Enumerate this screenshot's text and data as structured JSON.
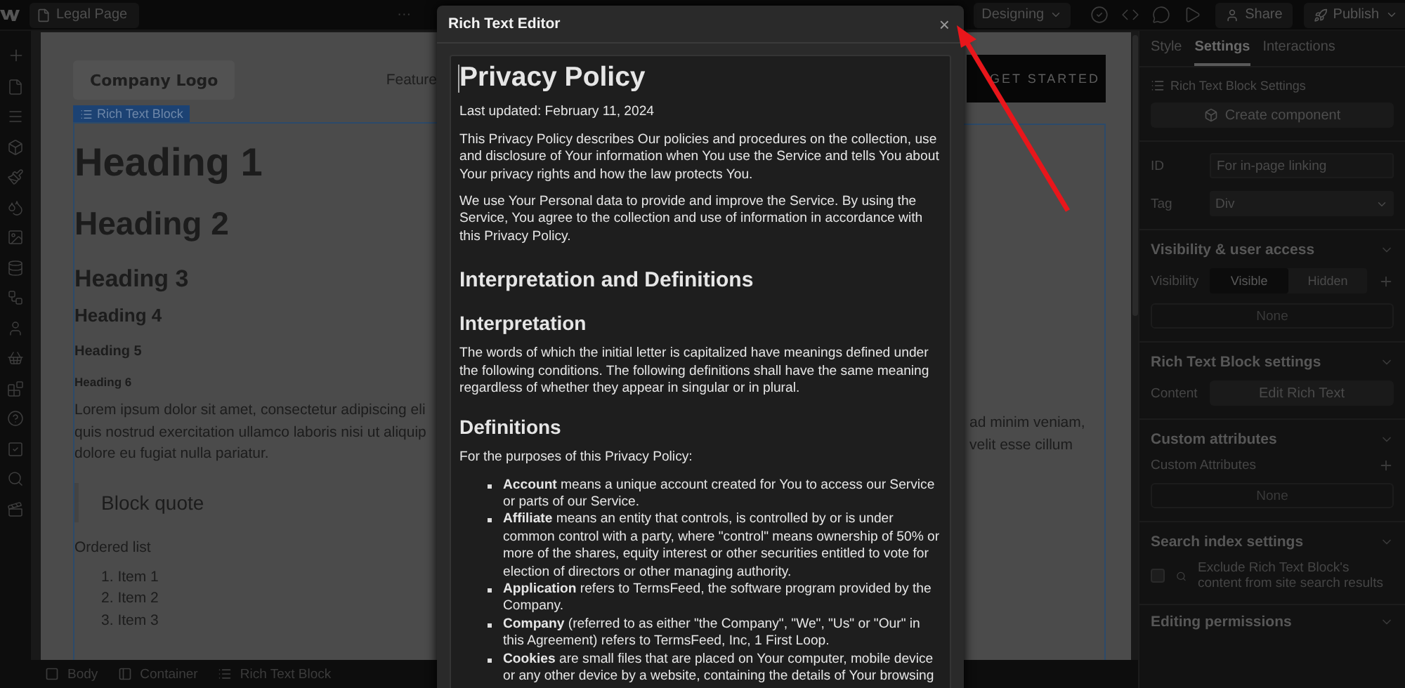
{
  "top_bar": {
    "page_button": "Legal Page",
    "more": "···",
    "mode_dropdown": "Designing",
    "share_button": "Share",
    "publish_button": "Publish"
  },
  "canvas": {
    "logo_button": "Company Logo",
    "nav_link": "Feature",
    "cta_button": "GET STARTED",
    "element_tag": "Rich Text Block",
    "headings": [
      {
        "kind": "h1",
        "text": "Heading 1"
      },
      {
        "kind": "h2",
        "text": "Heading 2"
      },
      {
        "kind": "h3",
        "text": "Heading 3"
      },
      {
        "kind": "h4",
        "text": "Heading 4"
      },
      {
        "kind": "h5",
        "text": "Heading 5"
      },
      {
        "kind": "h6",
        "text": "Heading 6"
      }
    ],
    "paragraph_left_lines": [
      "Lorem ipsum dolor sit amet, consectetur adipiscing eli",
      "quis nostrud exercitation ullamco laboris nisi ut aliquip",
      "dolore eu fugiat nulla pariatur."
    ],
    "paragraph_right_lines": [
      "ad minim veniam,",
      "velit esse cillum"
    ],
    "block_quote": "Block quote",
    "list_label": "Ordered list",
    "list_items": [
      {
        "marker": "1.",
        "text": "Item 1"
      },
      {
        "marker": "2.",
        "text": "Item 2"
      },
      {
        "marker": "3.",
        "text": "Item 3"
      }
    ]
  },
  "breadcrumbs": [
    {
      "kind": "body",
      "label": "Body"
    },
    {
      "kind": "container",
      "label": "Container"
    },
    {
      "kind": "richtext",
      "label": "Rich Text Block"
    }
  ],
  "modal": {
    "title": "Rich Text Editor",
    "close": "×",
    "content": [
      {
        "kind": "h1",
        "text": "Privacy Policy"
      },
      {
        "kind": "p",
        "text": "Last updated: February 11, 2024"
      },
      {
        "kind": "p",
        "text": "This Privacy Policy describes Our policies and procedures on the collection, use and disclosure of Your information when You use the Service and tells You about Your privacy rights and how the law protects You."
      },
      {
        "kind": "p",
        "text": "We use Your Personal data to provide and improve the Service. By using the Service, You agree to the collection and use of information in accordance with this Privacy Policy."
      },
      {
        "kind": "h2",
        "text": "Interpretation and Definitions"
      },
      {
        "kind": "h3",
        "text": "Interpretation"
      },
      {
        "kind": "p",
        "text": "The words of which the initial letter is capitalized have meanings defined under the following conditions. The following definitions shall have the same meaning regardless of whether they appear in singular or in plural."
      },
      {
        "kind": "h3",
        "text": "Definitions"
      },
      {
        "kind": "p",
        "text": "For the purposes of this Privacy Policy:"
      },
      {
        "kind": "list",
        "items": [
          "**Account** means a unique account created for You to access our Service or parts of our Service.",
          "**Affiliate** means an entity that controls, is controlled by or is under common control with a party, where \"control\" means ownership of 50% or more of the shares, equity interest or other securities entitled to vote for election of directors or other managing authority.",
          "**Application** refers to TermsFeed, the software program provided by the Company.",
          "**Company** (referred to as either \"the Company\", \"We\", \"Us\" or \"Our\" in this Agreement) refers to TermsFeed, Inc, 1 First Loop.",
          "**Cookies** are small files that are placed on Your computer, mobile device or any other device by a website, containing the details of Your browsing"
        ]
      }
    ]
  },
  "settings_panel": {
    "tabs": [
      {
        "label": "Style",
        "selected": false
      },
      {
        "label": "Settings",
        "selected": true
      },
      {
        "label": "Interactions",
        "selected": false
      }
    ],
    "element_title": "Rich Text Block Settings",
    "create_button": "Create component",
    "id_field": {
      "label": "ID",
      "placeholder": "For in-page linking"
    },
    "tag_field": {
      "label": "Tag",
      "value": "Div"
    },
    "sections": [
      {
        "kind": "visibility",
        "title": "Visibility & user access",
        "label": "Visibility",
        "options": [
          {
            "label": "Visible",
            "selected": true
          },
          {
            "label": "Hidden",
            "selected": false
          }
        ],
        "empty": "None"
      },
      {
        "kind": "content",
        "title": "Rich Text Block settings",
        "label": "Content",
        "button": "Edit Rich Text"
      },
      {
        "kind": "attributes",
        "title": "Custom attributes",
        "label": "Custom Attributes",
        "empty": "None"
      },
      {
        "kind": "search",
        "title": "Search index settings",
        "checked": false,
        "text": "Exclude Rich Text Block's content from site search results"
      },
      {
        "kind": "heading",
        "title": "Editing permissions"
      }
    ]
  }
}
